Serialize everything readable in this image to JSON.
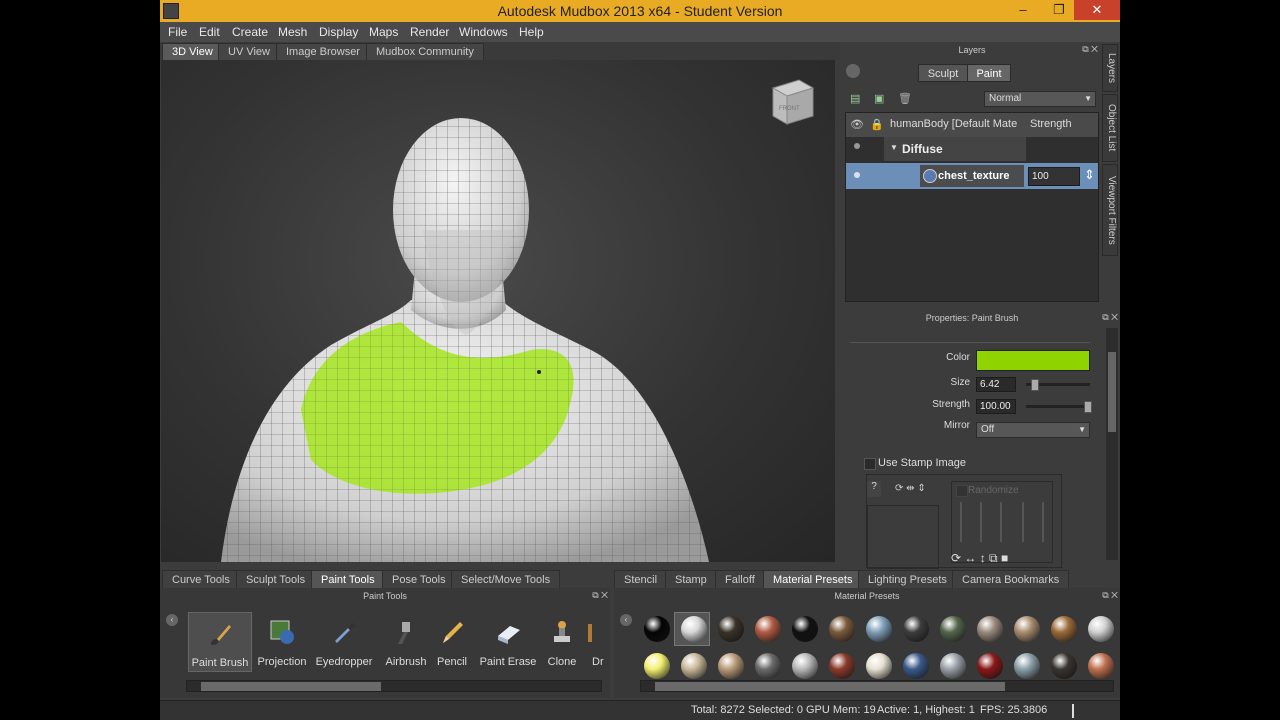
{
  "window": {
    "title": "Autodesk Mudbox 2013 x64 - Student Version",
    "minimize": "–",
    "restore": "❐",
    "close": "✕"
  },
  "menu": [
    "File",
    "Edit",
    "Create",
    "Mesh",
    "Display",
    "Maps",
    "Render",
    "Windows",
    "Help"
  ],
  "view_tabs": [
    "3D View",
    "UV View",
    "Image Browser",
    "Mudbox Community"
  ],
  "viewcube_label": "FRONT",
  "side_tabs": [
    "Layers",
    "Object List",
    "Viewport Filters"
  ],
  "layers": {
    "title": "Layers",
    "mode_tabs": [
      "Sculpt",
      "Paint"
    ],
    "blend_mode": "Normal",
    "header_name": "humanBody [Default Mate",
    "header_strength": "Strength",
    "group": "Diffuse",
    "layer_name": "chest_texture",
    "layer_strength": "100"
  },
  "properties": {
    "title": "Properties: Paint Brush",
    "color_label": "Color",
    "color_value": "#8fd400",
    "size_label": "Size",
    "size_value": "6.42",
    "strength_label": "Strength",
    "strength_value": "100.00",
    "mirror_label": "Mirror",
    "mirror_value": "Off",
    "stamp_label": "Use Stamp Image",
    "randomize_label": "Randomize"
  },
  "tool_tabs": [
    "Curve Tools",
    "Sculpt Tools",
    "Paint Tools",
    "Pose Tools",
    "Select/Move Tools"
  ],
  "tool_panel_title": "Paint Tools",
  "tools": [
    "Paint Brush",
    "Projection",
    "Eyedropper",
    "Airbrush",
    "Pencil",
    "Paint Erase",
    "Clone",
    "Dr"
  ],
  "preset_tabs": [
    "Stencil",
    "Stamp",
    "Falloff",
    "Material Presets",
    "Lighting Presets",
    "Camera Bookmarks"
  ],
  "preset_panel_title": "Material Presets",
  "material_colors": [
    "#050505",
    "#d8d8d8",
    "#3a3228",
    "#b05a44",
    "#111111",
    "#7a5a3c",
    "#7f9fb8",
    "#3c3c3c",
    "#55664c",
    "#9a8a7c",
    "#a88c70",
    "#9a6a3a",
    "#d0d0d0",
    "#f2f070",
    "#c8b89a",
    "#b89a78",
    "#6a6a6a",
    "#b8b8b8",
    "#8a3a2a",
    "#e6e0d0",
    "#3a5a8a",
    "#9aa0a8",
    "#8a1818",
    "#8aa0a8",
    "#3a3430",
    "#c07050"
  ],
  "status": {
    "total": "Total: 8272",
    "selected": "Selected: 0",
    "gpu": "GPU Mem: 19",
    "active": "Active: 1, Highest: 1",
    "fps": "FPS: 25.3806"
  }
}
